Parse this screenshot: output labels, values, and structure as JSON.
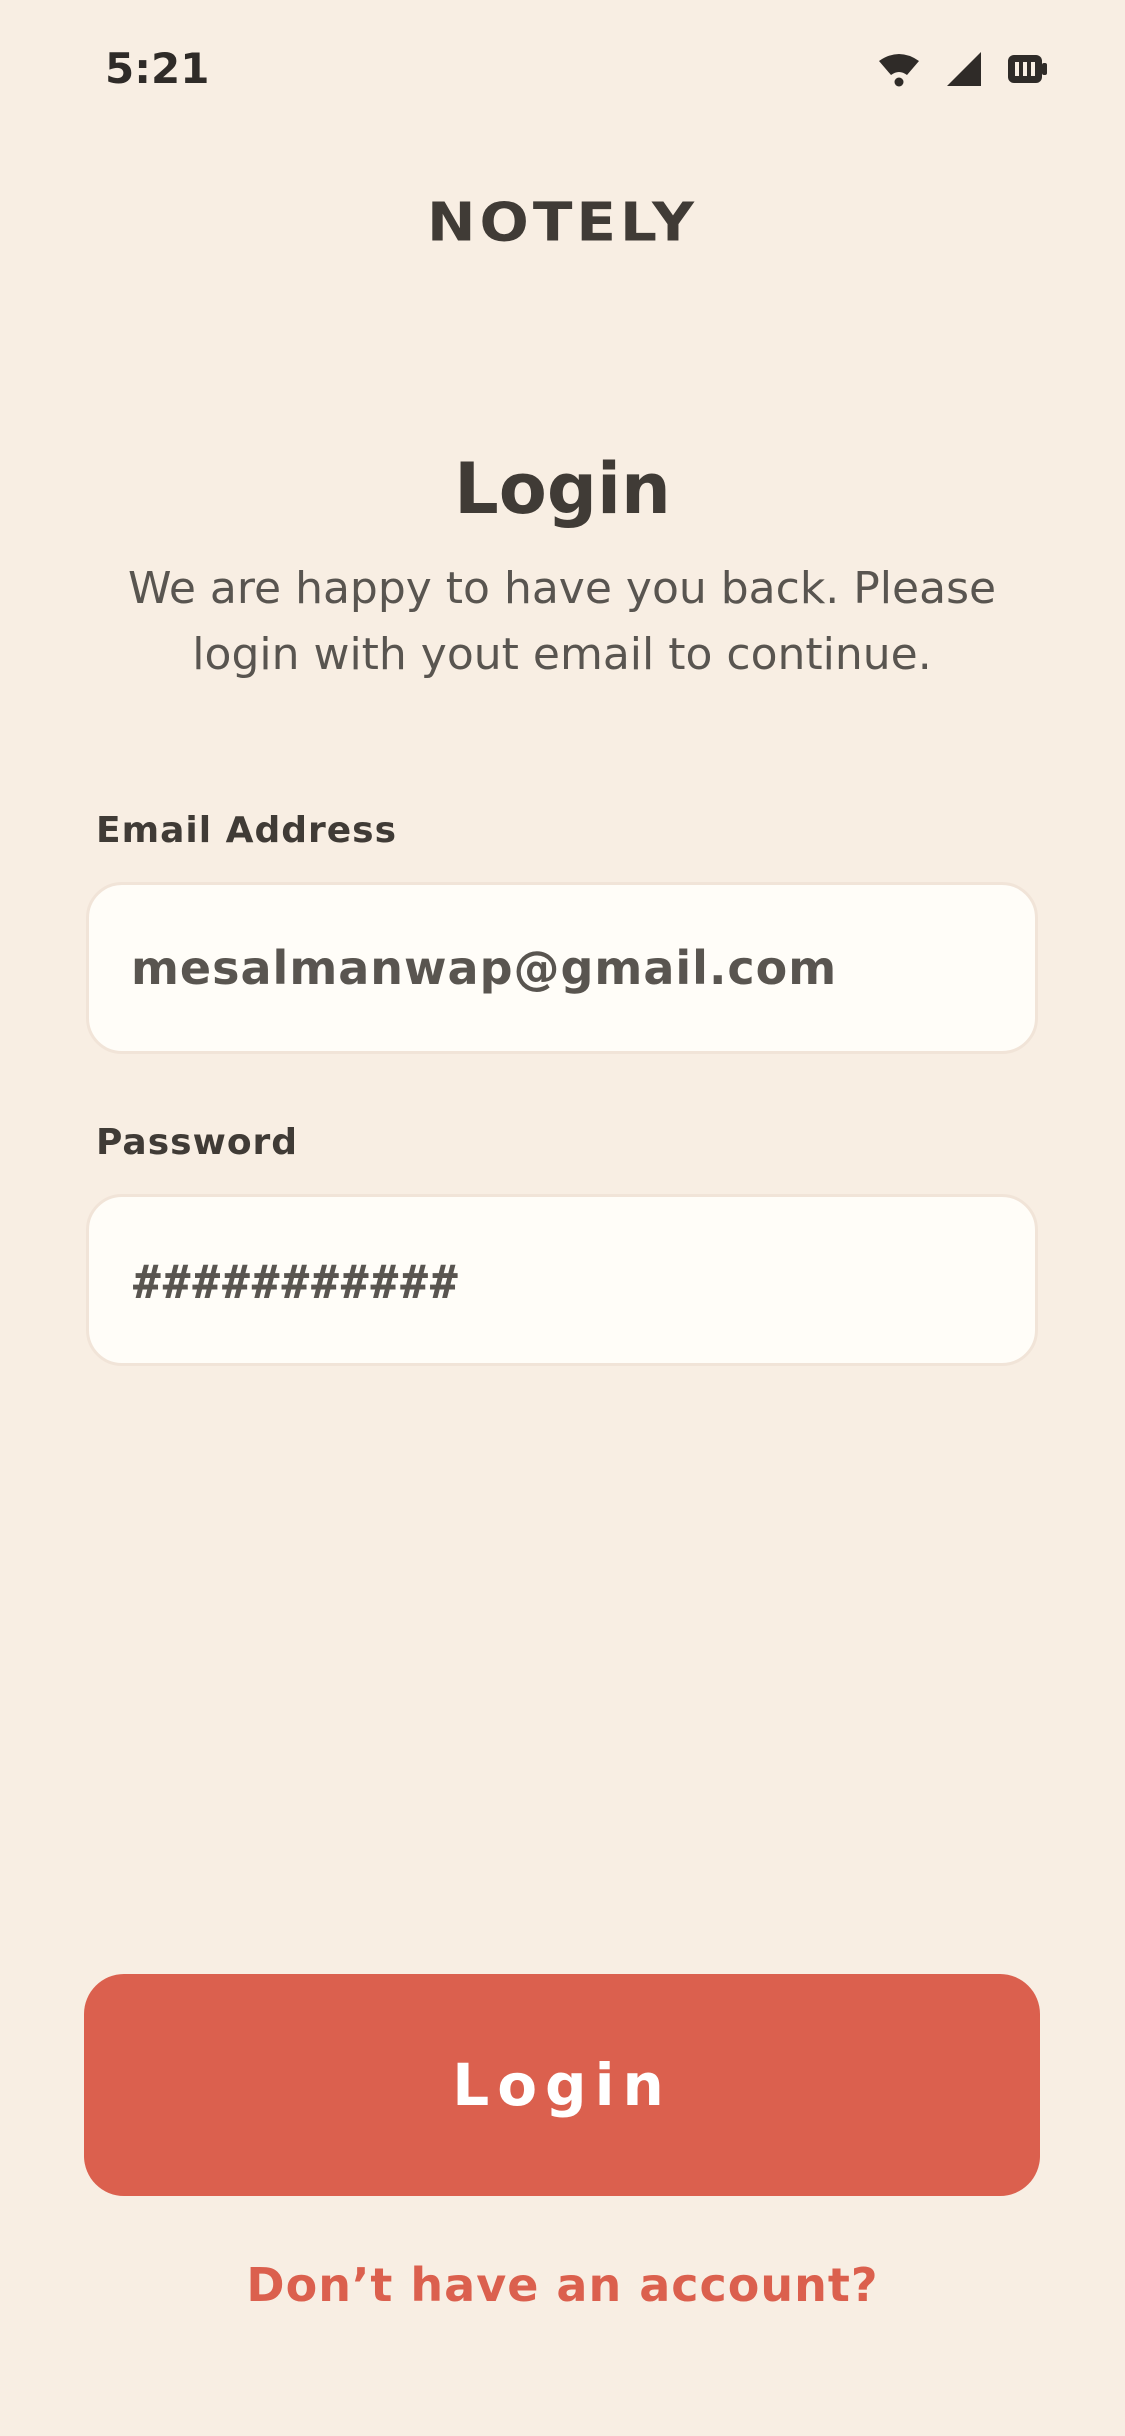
{
  "status_bar": {
    "time": "5:21",
    "icons": [
      "wifi-icon",
      "cellular-signal-icon",
      "battery-icon"
    ]
  },
  "app": {
    "logo": "NOTELY"
  },
  "header": {
    "title": "Login",
    "subtitle": "We are happy to have you back. Please login with yout email to continue."
  },
  "form": {
    "email": {
      "label": "Email Address",
      "value": "mesalmanwap@gmail.com"
    },
    "password": {
      "label": "Password",
      "value": "###########"
    }
  },
  "actions": {
    "login_label": "Login",
    "signup_link": "Don’t have an account?"
  },
  "colors": {
    "background": "#F8EEE3",
    "accent": "#DB604E",
    "text_dark": "#403B36",
    "field_bg": "#FFFDF8"
  }
}
